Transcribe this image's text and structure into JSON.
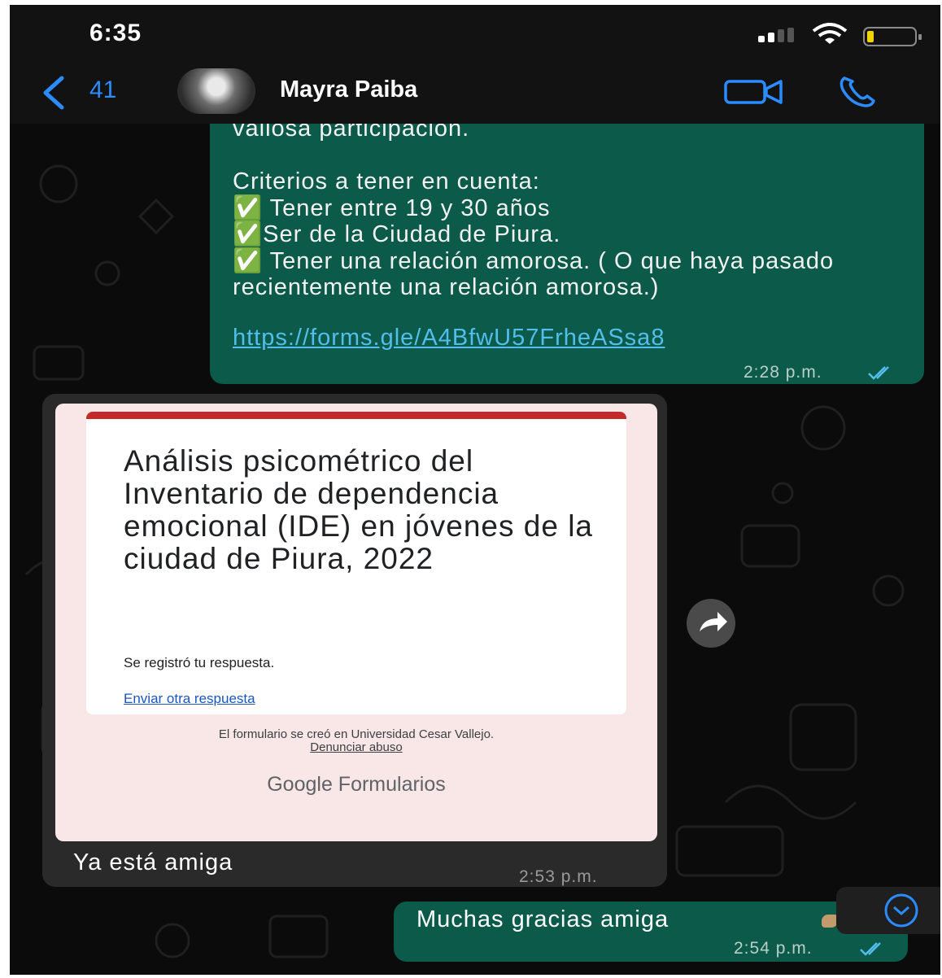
{
  "status_bar": {
    "time": "6:35"
  },
  "header": {
    "back_count": "41",
    "contact_name": "Mayra Paiba"
  },
  "messages": {
    "m1": {
      "body": "valiosa participación.\n\nCriterios a tener en cuenta:\n✅ Tener entre 19 y 30 años\n✅Ser de la Ciudad de Piura.\n✅ Tener una relación amorosa. ( O que haya pasado recientemente una relación amorosa.)",
      "link": "https://forms.gle/A4BfwU57FrheASsa8",
      "time": "2:28 p.m."
    },
    "m2": {
      "form_title": "Análisis psicométrico del Inventario de dependencia emocional (IDE) en jóvenes de la ciudad de Piura, 2022",
      "form_confirmation": "Se registró tu respuesta.",
      "form_another": "Enviar otra respuesta",
      "form_created": "El formulario se creó en Universidad Cesar Vallejo.",
      "form_report": "Denunciar abuso",
      "form_brand": "Google Formularios",
      "text": "Ya está amiga",
      "time": "2:53 p.m."
    },
    "m3": {
      "text": "Muchas gracias amiga",
      "time": "2:54 p.m."
    }
  },
  "colors": {
    "outgoing_bubble": "#0b5a4a",
    "incoming_bubble": "#2a2a2a",
    "accent_blue": "#2b8cff",
    "link": "#53bdeb",
    "read_ticks": "#53bdeb"
  },
  "icons": [
    "back-icon",
    "video-call-icon",
    "voice-call-icon",
    "forward-icon",
    "scroll-down-icon",
    "signal-icon",
    "wifi-icon",
    "battery-icon",
    "double-check-icon"
  ]
}
